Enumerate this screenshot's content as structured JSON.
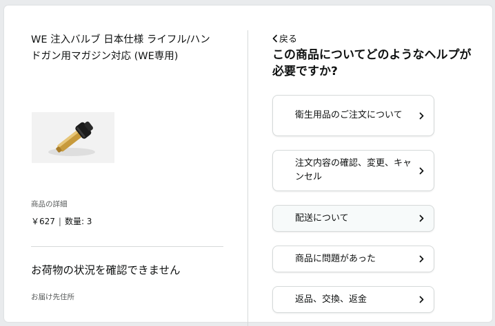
{
  "product": {
    "title": "WE 注入バルブ 日本仕様 ライフル/ハンドガン用マガジン対応 (WE専用)",
    "details_label": "商品の詳細",
    "price": "￥627",
    "quantity": "数量: 3"
  },
  "shipment": {
    "status_heading": "お荷物の状況を確認できません",
    "address_label": "お届け先住所"
  },
  "help": {
    "back_label": "戻る",
    "title": "この商品についてどのようなヘルプが必要ですか?",
    "options": [
      {
        "label": "衛生用品のご注文について"
      },
      {
        "label": "注文内容の確認、変更、キャンセル"
      },
      {
        "label": "配送について"
      },
      {
        "label": "商品に問題があった"
      },
      {
        "label": "返品、交換、返金"
      }
    ]
  }
}
